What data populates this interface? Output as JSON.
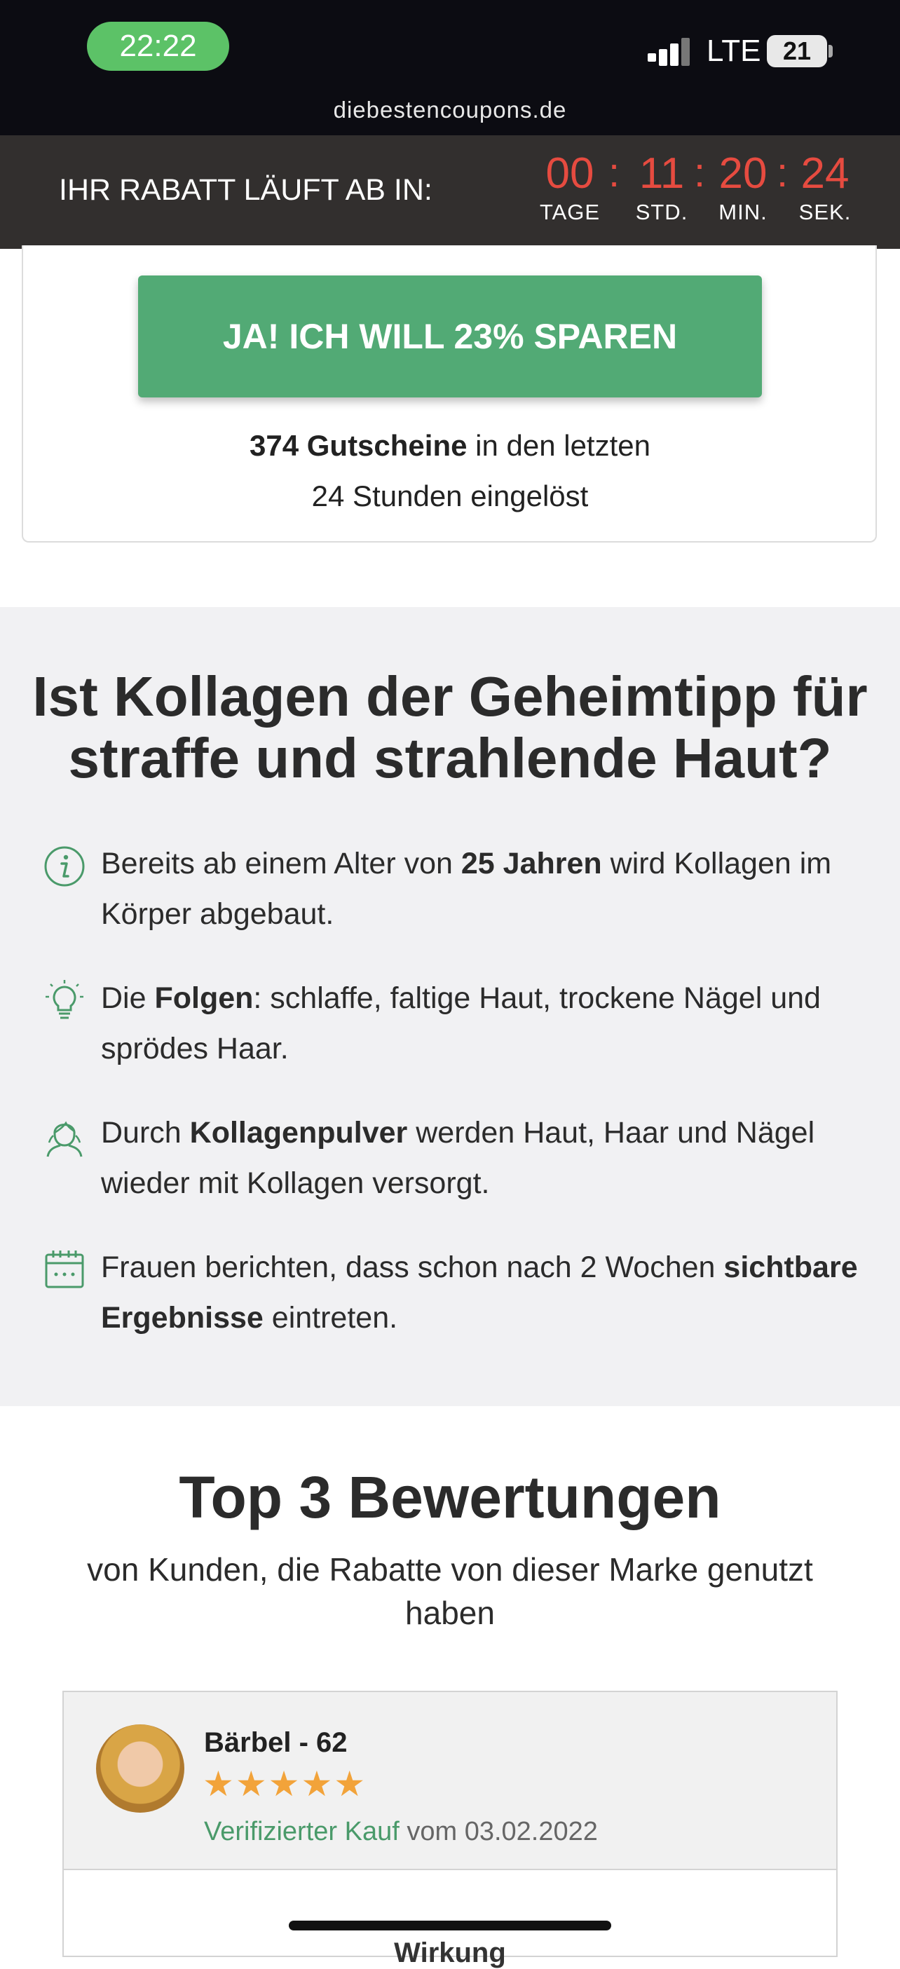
{
  "status_bar": {
    "time": "22:22",
    "network": "LTE",
    "battery": "21",
    "domain": "diebestencoupons.de",
    "colors": {
      "time_pill": "#5cc267",
      "background": "#0c0c12"
    }
  },
  "countdown": {
    "label": "IHR RABATT LÄUFT AB IN:",
    "units": [
      {
        "value": "00",
        "caption": "TAGE"
      },
      {
        "value": "11",
        "caption": "STD."
      },
      {
        "value": "20",
        "caption": "MIN."
      },
      {
        "value": "24",
        "caption": "SEK."
      }
    ],
    "separator": ":",
    "colors": {
      "digits": "#e64b40",
      "bar": "#322f2e"
    }
  },
  "coupon": {
    "cta_label": "JA! ICH WILL 23% SPAREN",
    "redeemed_count": "374 Gutscheine",
    "redeemed_rest": " in den letzten",
    "redeemed_line2": "24 Stunden eingelöst",
    "colors": {
      "cta": "#52aa75"
    }
  },
  "info_section": {
    "title_line1": "Ist Kollagen der Geheimtipp für",
    "title_line2": "straffe und strahlende Haut?",
    "bullets": [
      {
        "icon": "info-icon",
        "pre": "Bereits ab einem Alter von ",
        "bold": "25 Jahren",
        "post": " wird Kollagen im",
        "line2": "Körper abgebaut."
      },
      {
        "icon": "lightbulb-icon",
        "pre": "Die ",
        "bold": "Folgen",
        "post": ": schlaffe, faltige Haut, trockene Nägel und",
        "line2": "sprödes Haar."
      },
      {
        "icon": "woman-face-icon",
        "pre": "Durch ",
        "bold": "Kollagenpulver",
        "post": " werden Haut, Haar und Nägel",
        "line2": "wieder mit Kollagen versorgt."
      },
      {
        "icon": "calendar-icon",
        "pre": "Frauen berichten, dass schon nach 2 Wochen ",
        "bold": "sichtbare",
        "post": "",
        "line2_bold": "Ergebnisse",
        "line2": " eintreten."
      }
    ]
  },
  "reviews_section": {
    "title": "Top 3 Bewertungen",
    "subtitle": "von Kunden, die Rabatte von dieser Marke genutzt haben",
    "reviews": [
      {
        "name": "Bärbel - 62",
        "stars": "★★★★★",
        "rating": 5,
        "verified_label": "Verifizierter Kauf",
        "date_label": " vom 03.02.2022",
        "body_title": "Wirkung"
      }
    ]
  }
}
